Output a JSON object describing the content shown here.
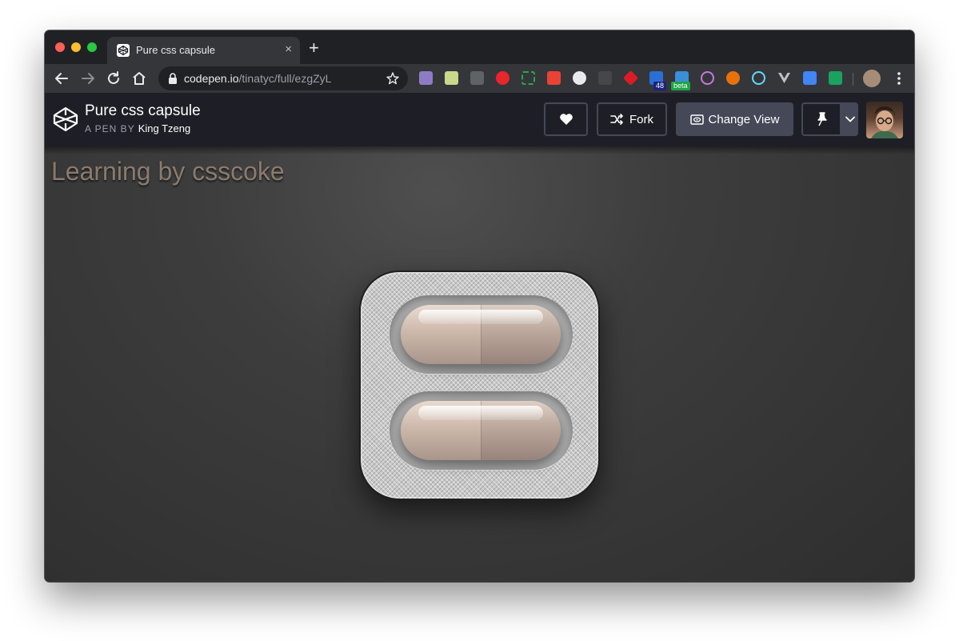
{
  "browser": {
    "tab": {
      "title": "Pure css capsule",
      "close_label": "×"
    },
    "new_tab_label": "+",
    "address": {
      "host": "codepen.io",
      "path": "/tinatyc/full/ezgZyL"
    },
    "extensions": [
      {
        "name": "grid-extension-icon",
        "color": "#8e7cc3"
      },
      {
        "name": "notes-extension-icon",
        "color": "#c9d88a"
      },
      {
        "name": "bold-extension-icon",
        "color": "#5f6368"
      },
      {
        "name": "adblock-extension-icon",
        "color": "#e8262b"
      },
      {
        "name": "screenshot-extension-icon",
        "color": "#2da44e"
      },
      {
        "name": "percent-extension-icon",
        "color": "#ea4335"
      },
      {
        "name": "github-extension-icon",
        "color": "#e8eaed"
      },
      {
        "name": "m-extension-icon",
        "color": "#5f6368"
      },
      {
        "name": "ruby-extension-icon",
        "color": "#d91c26"
      },
      {
        "name": "dropbox-48-extension-icon",
        "color": "#2b6fd6",
        "badge": "48"
      },
      {
        "name": "folder-beta-extension-icon",
        "color": "#3b8fd8",
        "badge": "beta"
      },
      {
        "name": "signal-extension-icon",
        "color": "#c678dd"
      },
      {
        "name": "fox-extension-icon",
        "color": "#e8710a"
      },
      {
        "name": "react-extension-icon",
        "color": "#61dafb"
      },
      {
        "name": "vue-extension-icon",
        "color": "#bdc1c6"
      },
      {
        "name": "translate-extension-icon",
        "color": "#4285f4"
      },
      {
        "name": "board-extension-icon",
        "color": "#1aa260"
      }
    ]
  },
  "codepen": {
    "pen_title": "Pure css capsule",
    "pen_by_label": "A PEN BY",
    "author": "King Tzeng",
    "fork_label": "Fork",
    "change_view_label": "Change View"
  },
  "content": {
    "heading": "Learning by csscoke"
  },
  "colors": {
    "accent_header": "#1e1f26",
    "button_border": "#444857",
    "heading": "#8a7b6e"
  }
}
